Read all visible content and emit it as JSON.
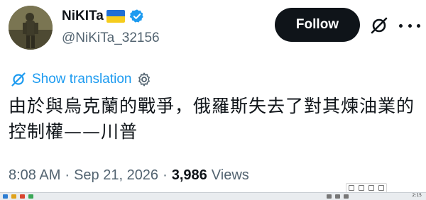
{
  "user": {
    "display_name": "NiKITa",
    "handle": "@NiKiTa_32156",
    "flag_icon": "ukraine-flag-icon",
    "verified_icon": "verified-badge-icon"
  },
  "actions": {
    "follow_label": "Follow",
    "grok_icon": "grok-icon",
    "more_icon": "more-icon"
  },
  "translation": {
    "label": "Show translation",
    "icon": "translate-icon",
    "settings_icon": "gear-icon"
  },
  "tweet": {
    "text_line1": "由於與烏克蘭的戰爭，俄羅斯失去了對其煉油業的",
    "text_line2": "控制權——川普"
  },
  "meta": {
    "time": "8:08 AM",
    "separator1": "·",
    "date": "Sep 21, 2026",
    "separator2": "·",
    "views_count": "3,986",
    "views_label": "Views"
  },
  "taskbar": {
    "clock": "2:15"
  },
  "colors": {
    "accent": "#1d9bf0",
    "text": "#0f1419",
    "secondary": "#536471",
    "follow_bg": "#0f1419"
  }
}
